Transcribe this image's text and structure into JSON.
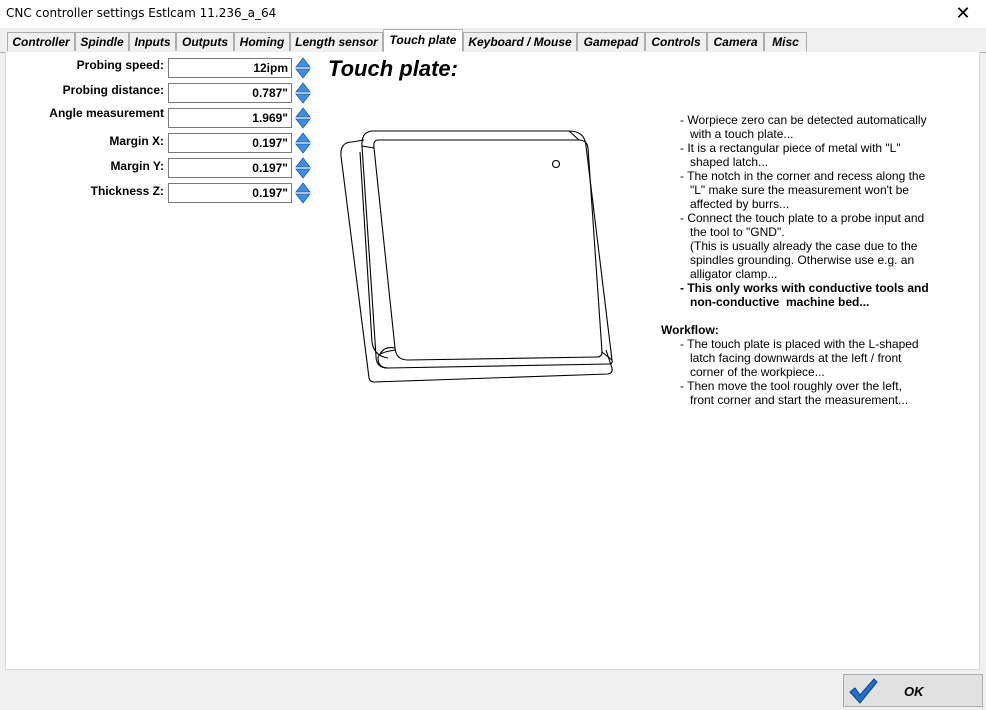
{
  "window": {
    "title": "CNC controller settings Estlcam 11.236_a_64"
  },
  "tabs": [
    {
      "label": "Controller"
    },
    {
      "label": "Spindle"
    },
    {
      "label": "Inputs"
    },
    {
      "label": "Outputs"
    },
    {
      "label": "Homing"
    },
    {
      "label": "Length sensor"
    },
    {
      "label": "Touch plate"
    },
    {
      "label": "Keyboard / Mouse"
    },
    {
      "label": "Gamepad"
    },
    {
      "label": "Controls"
    },
    {
      "label": "Camera"
    },
    {
      "label": "Misc"
    }
  ],
  "active_tab": "Touch plate",
  "fields": [
    {
      "label": "Probing speed:",
      "value": "12ipm"
    },
    {
      "label": "Probing distance:",
      "value": "0.787\""
    },
    {
      "label": "Angle measurement",
      "value": "1.969\""
    },
    {
      "label": "Margin X:",
      "value": "0.197\""
    },
    {
      "label": "Margin Y:",
      "value": "0.197\""
    },
    {
      "label": "Thickness Z:",
      "value": "0.197\""
    }
  ],
  "section_title": "Touch plate:",
  "description": [
    "- Worpiece zero can be detected automatically",
    "   with a touch plate...",
    "- It is a rectangular piece of metal with \"L\"",
    "   shaped latch...",
    "- The notch in the corner and recess along the",
    "   \"L\" make sure the measurement won't be",
    "   affected by burrs...",
    "- Connect the touch plate to a probe input and",
    "   the tool to \"GND\".",
    "   (This is usually already the case due to the",
    "   spindles grounding. Otherwise use e.g. an",
    "   alligator clamp..."
  ],
  "description_bold": [
    "- This only works with conductive tools and",
    "   non-conductive  machine bed..."
  ],
  "workflow_title": "Workflow:",
  "workflow": [
    "- The touch plate is placed with the L-shaped",
    "   latch facing downwards at the left / front",
    "   corner of the workpiece...",
    "- Then move the tool roughly over the left,",
    "   front corner and start the measurement..."
  ],
  "ok_button": {
    "label": "OK"
  },
  "colors": {
    "spin_arrow": "#3c8ee6",
    "check": "#1f6fd1"
  }
}
